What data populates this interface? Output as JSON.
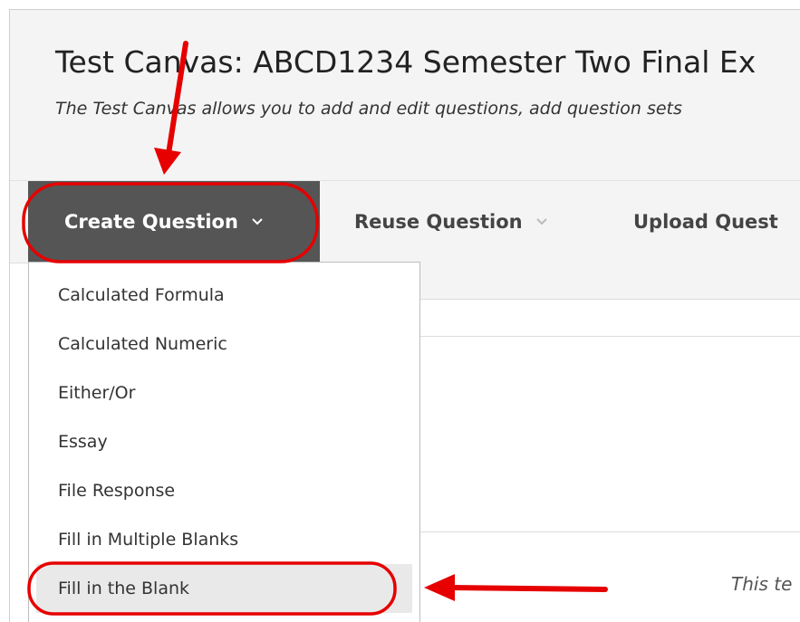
{
  "header": {
    "title": "Test Canvas: ABCD1234 Semester Two Final Ex",
    "subtitle": "The Test Canvas allows you to add and edit questions, add question sets"
  },
  "action_bar": {
    "create_question": "Create Question",
    "reuse_question": "Reuse Question",
    "upload_questions": "Upload Quest"
  },
  "dropdown": {
    "items": [
      {
        "label": "Calculated Formula"
      },
      {
        "label": "Calculated Numeric"
      },
      {
        "label": "Either/Or"
      },
      {
        "label": "Essay"
      },
      {
        "label": "File Response"
      },
      {
        "label": "Fill in Multiple Blanks"
      },
      {
        "label": "Fill in the Blank"
      }
    ],
    "highlighted_item": "Fill in the Blank"
  },
  "content": {
    "truncated_note": "This te"
  },
  "colors": {
    "annotation_red": "#e60000",
    "create_button_bg": "#555555",
    "header_bg": "#f4f4f4"
  },
  "icons": {
    "dropdown_chevron": "chevron-down-icon",
    "annotation_arrow": "arrow-icon"
  }
}
